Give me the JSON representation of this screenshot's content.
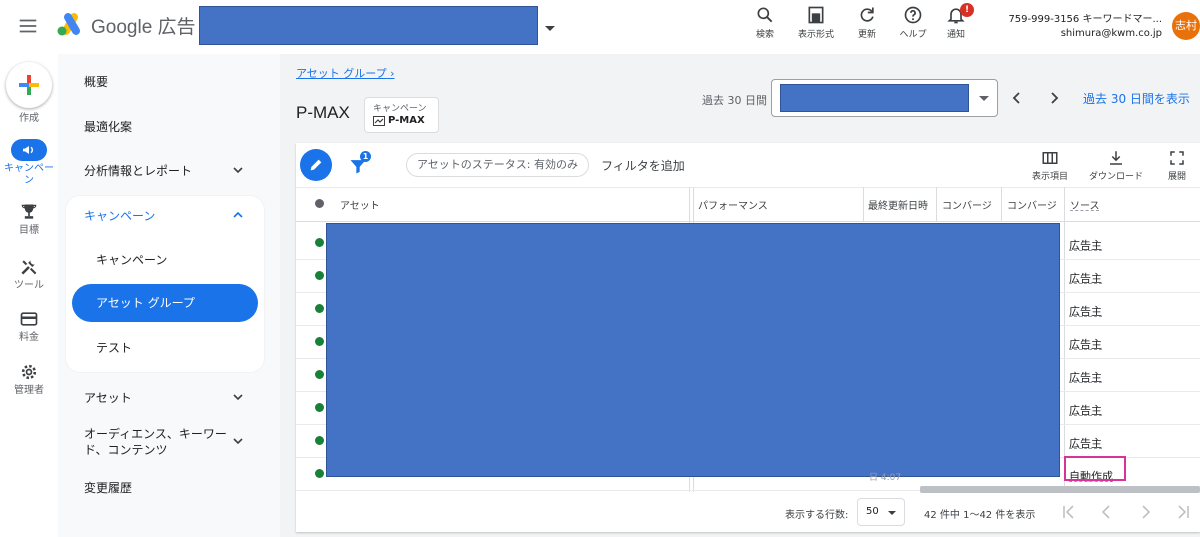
{
  "header": {
    "product_name": "Google 広告",
    "tools": [
      {
        "label": "検索",
        "icon": "search-icon"
      },
      {
        "label": "表示形式",
        "icon": "appearance-icon"
      },
      {
        "label": "更新",
        "icon": "refresh-icon"
      },
      {
        "label": "ヘルプ",
        "icon": "help-icon"
      },
      {
        "label": "通知",
        "icon": "bell-icon",
        "badge": "!"
      }
    ],
    "account_line1": "759-999-3156 キーワードマー...",
    "account_line2": "shimura@kwm.co.jp",
    "avatar_text": "志村"
  },
  "rail": {
    "create_label": "作成",
    "items": [
      {
        "label": "キャンペーン",
        "icon": "megaphone-icon",
        "active": true
      },
      {
        "label": "目標",
        "icon": "trophy-icon"
      },
      {
        "label": "ツール",
        "icon": "tools-icon"
      },
      {
        "label": "料金",
        "icon": "credit-card-icon"
      },
      {
        "label": "管理者",
        "icon": "gear-icon"
      }
    ]
  },
  "nav": {
    "overview": "概要",
    "recommendations": "最適化案",
    "insights": "分析情報とレポート",
    "campaigns_group": "キャンペーン",
    "campaigns": "キャンペーン",
    "asset_groups": "アセット グループ",
    "experiments": "テスト",
    "assets": "アセット",
    "audiences_line1": "オーディエンス、キーワー",
    "audiences_line2": "ド、コンテンツ",
    "change_history": "変更履歴"
  },
  "page": {
    "breadcrumb": "アセット グループ",
    "title": "P-MAX",
    "chip_type": "キャンペーン",
    "chip_value": "P-MAX",
    "date_label": "過去 30 日間",
    "date_link": "過去 30 日間を表示"
  },
  "toolbar": {
    "filter_badge": "1",
    "status_filter": "アセットのステータス: 有効のみ",
    "add_filter": "フィルタを追加",
    "columns": "表示項目",
    "download": "ダウンロード",
    "expand": "展開"
  },
  "table": {
    "headers": [
      "アセット",
      "パフォーマンス",
      "最終更新日時",
      "コンバージ",
      "コンバージ",
      "ソース"
    ],
    "rows": [
      {
        "source": "広告主"
      },
      {
        "source": "広告主"
      },
      {
        "source": "広告主"
      },
      {
        "source": "広告主"
      },
      {
        "source": "広告主"
      },
      {
        "source": "広告主"
      },
      {
        "source": "広告主"
      },
      {
        "source": "自動作成"
      }
    ],
    "partial_date": "日 4:07"
  },
  "footer": {
    "rows_label": "表示する行数:",
    "rows_value": "50",
    "range": "42 件中 1〜42 件を表示"
  },
  "colors": {
    "accent": "#1a73e8",
    "redaction": "#4472c4",
    "highlight": "#d6339b",
    "status_ok": "#188038"
  }
}
